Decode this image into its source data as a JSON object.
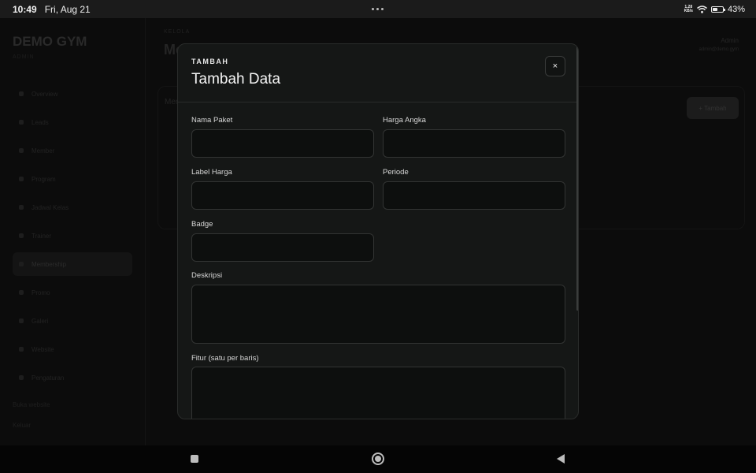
{
  "status": {
    "time": "10:49",
    "date": "Fri, Aug 21",
    "net_value": "1.28",
    "net_unit": "KB/s",
    "battery": "43%",
    "battery_level": 0.43
  },
  "app": {
    "brand": "DEMO GYM",
    "brand_sub": "ADMIN",
    "nav": [
      "Overview",
      "Leads",
      "Member",
      "Program",
      "Jadwal Kelas",
      "Trainer",
      "Membership",
      "Promo",
      "Galeri",
      "Website",
      "Pengaturan"
    ],
    "active_nav": 6,
    "footer_link": "Buka website",
    "footer_logout": "Keluar",
    "crumb": "KELOLA",
    "page_title": "Membership",
    "user": "Admin",
    "user_email": "admin@demo.gym",
    "section_title": "Membership",
    "add_label": "+ Tambah"
  },
  "modal": {
    "eyebrow": "TAMBAH",
    "title": "Tambah Data",
    "close": "×",
    "fields": {
      "nama_paket": {
        "label": "Nama Paket",
        "value": ""
      },
      "harga_angka": {
        "label": "Harga Angka",
        "value": ""
      },
      "label_harga": {
        "label": "Label Harga",
        "value": ""
      },
      "periode": {
        "label": "Periode",
        "value": ""
      },
      "badge": {
        "label": "Badge",
        "value": ""
      },
      "deskripsi": {
        "label": "Deskripsi",
        "value": ""
      },
      "fitur": {
        "label": "Fitur (satu per baris)",
        "value": ""
      }
    }
  }
}
